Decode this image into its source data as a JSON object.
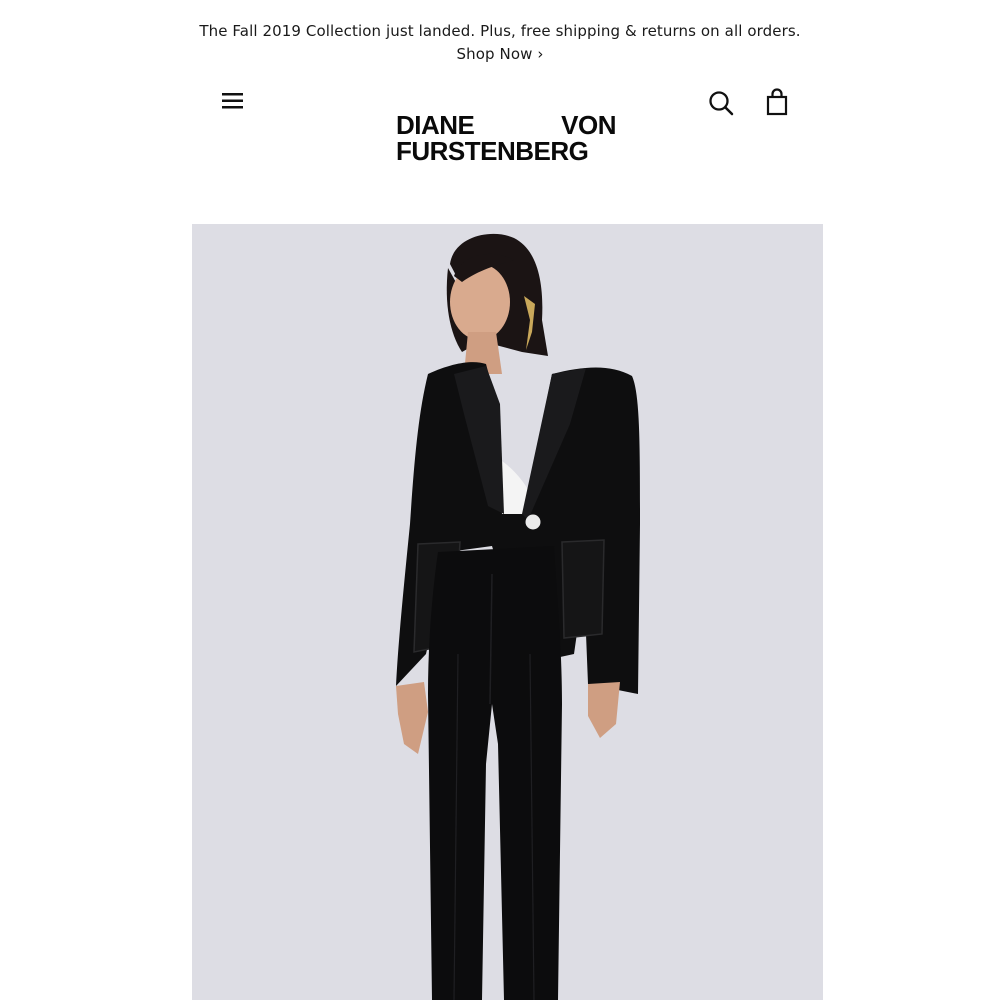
{
  "promo": {
    "message": "The Fall 2019 Collection just landed. Plus, free shipping & returns on all orders.",
    "link_label": "Shop Now ›"
  },
  "header": {
    "logo_line1_left": "DIANE",
    "logo_line1_right": "VON",
    "logo_line2": "FURSTENBERG",
    "icons": [
      "menu-icon",
      "search-icon",
      "shopping-bag-icon"
    ]
  },
  "colors": {
    "background": "#ffffff",
    "hero_background": "#dddde4",
    "text": "#111111"
  }
}
